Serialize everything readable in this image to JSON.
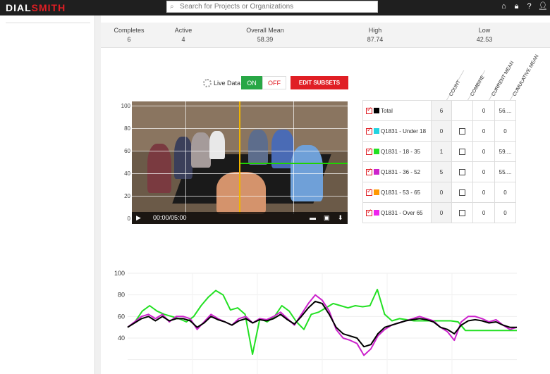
{
  "topbar": {
    "logo_part1": "DIAL",
    "logo_part2": "SMITH",
    "search_placeholder": "Search for Projects or Organizations",
    "icons": [
      "home-icon",
      "lock-icon",
      "help-icon",
      "user-icon"
    ]
  },
  "stats": [
    {
      "label": "Completes",
      "value": "6"
    },
    {
      "label": "Active",
      "value": "4"
    },
    {
      "label": "Overall Mean",
      "value": "58.39"
    },
    {
      "label": "High",
      "value": "87.74"
    },
    {
      "label": "Low",
      "value": "42.53"
    }
  ],
  "controls": {
    "live_label": "Live Data",
    "on_label": "ON",
    "off_label": "OFF",
    "edit_label": "EDIT SUBSETS"
  },
  "video": {
    "time": "00:00/05:00",
    "axis": [
      "100",
      "80",
      "60",
      "40",
      "20",
      "0"
    ]
  },
  "subsets": {
    "headers": [
      "COUNT",
      "COMBINE",
      "CURRENT MEAN",
      "CUMULATIVE MEAN"
    ],
    "rows": [
      {
        "name": "Total",
        "color": "#000000",
        "count": "6",
        "current": "0",
        "cumulative": "56...."
      },
      {
        "name": "Q1831 - Under 18",
        "color": "#22d3e0",
        "count": "0",
        "current": "0",
        "cumulative": "0"
      },
      {
        "name": "Q1831 - 18 - 35",
        "color": "#22e022",
        "count": "1",
        "current": "0",
        "cumulative": "59...."
      },
      {
        "name": "Q1831 - 36 - 52",
        "color": "#cc22cc",
        "count": "5",
        "current": "0",
        "cumulative": "55...."
      },
      {
        "name": "Q1831 - 53 - 65",
        "color": "#ff9900",
        "count": "0",
        "current": "0",
        "cumulative": "0"
      },
      {
        "name": "Q1831 - Over 65",
        "color": "#ee22ee",
        "count": "0",
        "current": "0",
        "cumulative": "0"
      }
    ]
  },
  "chart_data": {
    "type": "line",
    "ylim": [
      10,
      100
    ],
    "yticks": [
      "100",
      "80",
      "60",
      "40"
    ],
    "grid": true,
    "series": [
      {
        "color": "#22e022",
        "values": [
          50,
          55,
          65,
          70,
          65,
          62,
          60,
          58,
          55,
          60,
          70,
          78,
          84,
          80,
          66,
          68,
          62,
          25,
          58,
          55,
          60,
          70,
          65,
          55,
          48,
          62,
          64,
          68,
          72,
          70,
          68,
          70,
          69,
          70,
          85,
          62,
          56,
          58,
          57,
          56,
          56,
          56,
          56,
          56,
          56,
          55,
          47,
          47,
          47,
          47,
          47,
          47,
          47,
          47
        ]
      },
      {
        "color": "#cc22cc",
        "values": [
          50,
          55,
          60,
          62,
          58,
          62,
          55,
          60,
          60,
          58,
          48,
          55,
          62,
          58,
          55,
          52,
          58,
          60,
          54,
          58,
          57,
          60,
          64,
          58,
          52,
          62,
          72,
          80,
          75,
          65,
          48,
          40,
          38,
          35,
          24,
          30,
          42,
          48,
          52,
          54,
          56,
          58,
          60,
          58,
          56,
          50,
          46,
          38,
          55,
          60,
          60,
          58,
          55,
          57,
          52,
          48,
          50
        ]
      },
      {
        "color": "#000000",
        "values": [
          50,
          54,
          58,
          60,
          56,
          60,
          56,
          58,
          58,
          56,
          50,
          54,
          60,
          57,
          55,
          52,
          56,
          58,
          54,
          57,
          56,
          58,
          62,
          57,
          53,
          60,
          68,
          74,
          72,
          62,
          50,
          44,
          42,
          40,
          32,
          34,
          44,
          50,
          52,
          54,
          56,
          57,
          58,
          57,
          55,
          50,
          48,
          44,
          52,
          56,
          57,
          56,
          54,
          55,
          52,
          50,
          50
        ]
      }
    ]
  }
}
